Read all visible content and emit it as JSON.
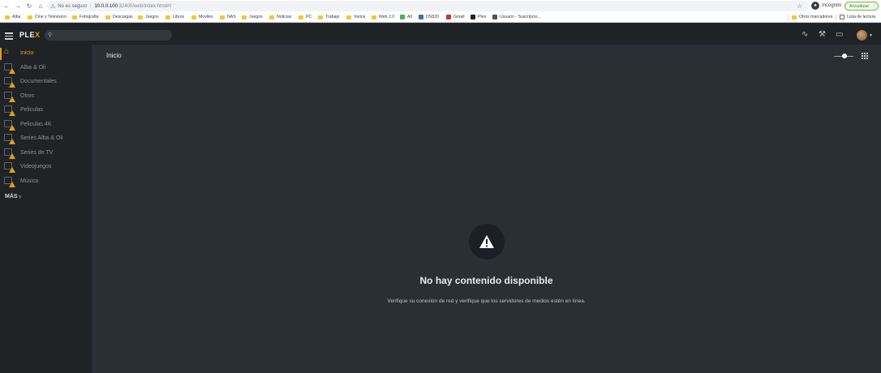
{
  "browser": {
    "security_label": "No es seguro",
    "url_host": "10.0.0.100",
    "url_rest": ":32400/web/index.html#!/",
    "incognito_label": "Incógnito",
    "update_label": "Actualizar"
  },
  "bookmarks": {
    "items": [
      "Alba",
      "Cine y Television",
      "Fotografia",
      "Descargas",
      "Juegos",
      "Libros",
      "Moviles",
      "NAS",
      "Juegos",
      "Noticias",
      "PC",
      "Trabajo",
      "Varios",
      "Web 2.0",
      "All",
      "DS820",
      "Gmail",
      "Plex",
      "Usuario - Suscripcio..."
    ],
    "other_label": "Otros marcadores",
    "reading_list_label": "Lista de lectura"
  },
  "app": {
    "logo_main": "PLE",
    "logo_x": "X",
    "accent_color": "#e5a00d"
  },
  "sidebar": {
    "items": [
      {
        "label": "Inicio",
        "icon": "home-icon"
      },
      {
        "label": "Alba & Oli",
        "icon": "library-warning-icon"
      },
      {
        "label": "Documentales",
        "icon": "library-warning-icon"
      },
      {
        "label": "Otros",
        "icon": "library-warning-icon"
      },
      {
        "label": "Peliculas",
        "icon": "library-warning-icon"
      },
      {
        "label": "Peliculas 4K",
        "icon": "library-warning-icon"
      },
      {
        "label": "Series Alba & Oli",
        "icon": "library-warning-icon"
      },
      {
        "label": "Series de TV",
        "icon": "library-warning-icon"
      },
      {
        "label": "Videojuegos",
        "icon": "library-warning-icon"
      },
      {
        "label": "Música",
        "icon": "library-warning-icon"
      }
    ],
    "more_label": "MÁS"
  },
  "main": {
    "title": "Inicio",
    "empty_title": "No hay contenido disponible",
    "empty_message": "Verifique su conexión de red y verifique que los servidores de medios estén en línea."
  }
}
